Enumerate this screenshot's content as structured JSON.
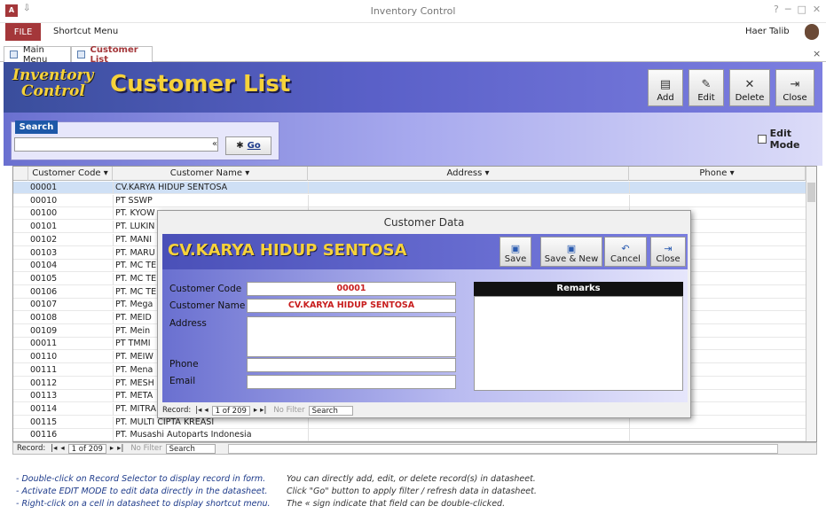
{
  "app": {
    "title": "Inventory Control",
    "user": "Haer Talib"
  },
  "ribbon": {
    "file": "FILE",
    "shortcut_menu": "Shortcut Menu"
  },
  "tabs": [
    {
      "label": "Main Menu"
    },
    {
      "label": "Customer List"
    }
  ],
  "header": {
    "logo_line1": "Inventory",
    "logo_line2": "Control",
    "title": "Customer List"
  },
  "toolbar": {
    "add": "Add",
    "edit": "Edit",
    "delete": "Delete",
    "close": "Close"
  },
  "search": {
    "label": "Search",
    "value": "",
    "double_click_sign": "«",
    "go": "Go"
  },
  "edit_mode": {
    "label": "Edit Mode",
    "checked": false
  },
  "datasheet": {
    "columns": [
      "Customer Code",
      "Customer Name",
      "Address",
      "Phone"
    ],
    "rows": [
      {
        "code": "00001",
        "name": "CV.KARYA HIDUP SENTOSA"
      },
      {
        "code": "00010",
        "name": "PT SSWP"
      },
      {
        "code": "00100",
        "name": "PT. KYOW"
      },
      {
        "code": "00101",
        "name": "PT. LUKIN"
      },
      {
        "code": "00102",
        "name": "PT. MANI"
      },
      {
        "code": "00103",
        "name": "PT. MARU"
      },
      {
        "code": "00104",
        "name": "PT. MC TE"
      },
      {
        "code": "00105",
        "name": "PT. MC TE"
      },
      {
        "code": "00106",
        "name": "PT. MC TE"
      },
      {
        "code": "00107",
        "name": "PT. Mega"
      },
      {
        "code": "00108",
        "name": "PT. MEID"
      },
      {
        "code": "00109",
        "name": "PT. Mein"
      },
      {
        "code": "00011",
        "name": "PT TMMI"
      },
      {
        "code": "00110",
        "name": "PT. MEIW"
      },
      {
        "code": "00111",
        "name": "PT. Mena"
      },
      {
        "code": "00112",
        "name": "PT. MESH"
      },
      {
        "code": "00113",
        "name": "PT. META"
      },
      {
        "code": "00114",
        "name": "PT. MITRA METAL INDONESIA"
      },
      {
        "code": "00115",
        "name": "PT. MULTI CIPTA KREASI"
      },
      {
        "code": "00116",
        "name": "PT. Musashi Autoparts Indonesia"
      }
    ]
  },
  "record_nav": {
    "label": "Record:",
    "position": "1 of 209",
    "no_filter": "No Filter",
    "search": "Search"
  },
  "popup": {
    "window_title": "Customer Data",
    "heading": "CV.KARYA HIDUP SENTOSA",
    "buttons": {
      "save": "Save",
      "save_new": "Save & New",
      "cancel": "Cancel",
      "close": "Close"
    },
    "fields": {
      "code_label": "Customer Code",
      "code_value": "00001",
      "name_label": "Customer Name",
      "name_value": "CV.KARYA HIDUP SENTOSA",
      "address_label": "Address",
      "phone_label": "Phone",
      "email_label": "Email"
    },
    "remarks_label": "Remarks"
  },
  "notes": {
    "left": [
      "- Double-click on Record Selector to display record in form.",
      "- Activate EDIT MODE to edit data directly in the datasheet.",
      "- Right-click on a cell in datasheet to display shortcut menu."
    ],
    "right": [
      "You can directly add, edit, or delete record(s) in datasheet.",
      "Click \"Go\" button to apply filter / refresh data in datasheet.",
      "The « sign indicate that field can be double-clicked."
    ]
  },
  "colors": {
    "accent": "#a4373a",
    "header_yellow": "#f6d23a",
    "band_blue": "#4a50b8"
  }
}
